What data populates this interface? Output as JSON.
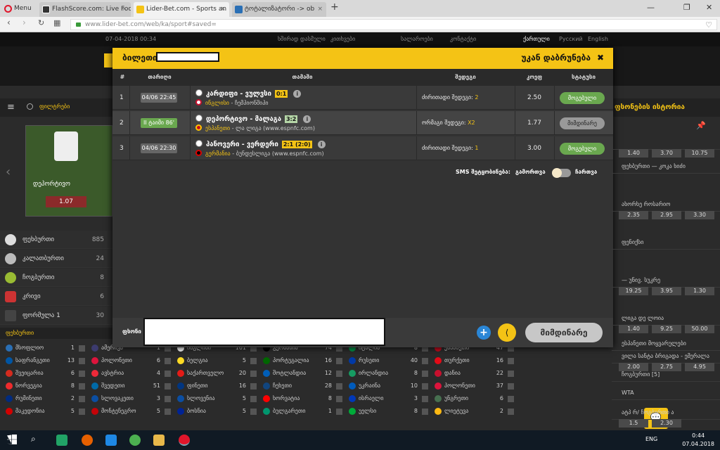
{
  "browser": {
    "menu_label": "Menu",
    "tabs": [
      {
        "label": "FlashScore.com: Live Footb",
        "active": false
      },
      {
        "label": "Lider-Bet.com - Sports an",
        "active": true
      },
      {
        "label": "ტოტალიზატორი -> ob",
        "active": false
      }
    ],
    "new_tab": "+",
    "url": "www.lider-bet.com/web/ka/sport#saved="
  },
  "site": {
    "datetime": "07-04-2018 00:34",
    "top_links": [
      "ხშირად დასმული",
      "კითხვები",
      "სალაროები",
      "კონტაქტი"
    ],
    "languages": [
      "ქართული",
      "Русский",
      "English"
    ],
    "search_label": "ფილტრები",
    "hero_team": "დეპორტივო",
    "hero_odds": "1.07",
    "sports": [
      {
        "name": "ფეხბურთი",
        "count": "885"
      },
      {
        "name": "კალათბურთი",
        "count": "24"
      },
      {
        "name": "ჩოგბურთი",
        "count": "8"
      },
      {
        "name": "კრივი",
        "count": "6"
      },
      {
        "name": "ფორმულა 1",
        "count": "30"
      }
    ],
    "countries_header": "ფეხბურთი",
    "countries": [
      {
        "name": "მსოფლიო",
        "count": "1"
      },
      {
        "name": "საფრანგეთი",
        "count": "13"
      },
      {
        "name": "შვეიცარია",
        "count": "6"
      },
      {
        "name": "ნორვეგია",
        "count": "8"
      },
      {
        "name": "რუმინეთი",
        "count": "2"
      },
      {
        "name": "მაკედონია",
        "count": "5"
      },
      {
        "name": "ამერიკა",
        "count": "1"
      },
      {
        "name": "პოლონეთი",
        "count": "6"
      },
      {
        "name": "ავსტრია",
        "count": "4"
      },
      {
        "name": "შვედეთი",
        "count": "51"
      },
      {
        "name": "სლოვაკეთი",
        "count": "3"
      },
      {
        "name": "მონტენეგრო",
        "count": "5"
      },
      {
        "name": "ინგლისი",
        "count": "161"
      },
      {
        "name": "ბელგია",
        "count": "5"
      },
      {
        "name": "საქართველო",
        "count": "20"
      },
      {
        "name": "ფინეთი",
        "count": "16"
      },
      {
        "name": "სლოვენია",
        "count": "5"
      },
      {
        "name": "ბოსნია",
        "count": "5"
      },
      {
        "name": "გერმანია",
        "count": "74"
      },
      {
        "name": "პორტუგალია",
        "count": "16"
      },
      {
        "name": "შოტლანდია",
        "count": "12"
      },
      {
        "name": "ჩეხეთი",
        "count": "28"
      },
      {
        "name": "ხორვატია",
        "count": "8"
      },
      {
        "name": "ბულგარეთი",
        "count": "1"
      },
      {
        "name": "იტალია",
        "count": "8"
      },
      {
        "name": "რუსეთი",
        "count": "40"
      },
      {
        "name": "ირლანდია",
        "count": "8"
      },
      {
        "name": "უკრაინა",
        "count": "10"
      },
      {
        "name": "ისრაელი",
        "count": "3"
      },
      {
        "name": "უელსი",
        "count": "8"
      },
      {
        "name": "ესპანეთი",
        "count": "47"
      },
      {
        "name": "თურქეთი",
        "count": "16"
      },
      {
        "name": "დანია",
        "count": "22"
      },
      {
        "name": "პოლონეთი",
        "count": "37"
      },
      {
        "name": "უნგრეთი",
        "count": "6"
      },
      {
        "name": "ლიეტუვა",
        "count": "2"
      }
    ],
    "right_panel": {
      "history_title": "ფსონების ისტორია",
      "rows": [
        {
          "text": "",
          "odds": [
            "1.40",
            "3.70",
            "10.75"
          ]
        },
        {
          "text": "ფეხბურთი — კოკა ხიძი",
          "odds": []
        },
        {
          "text": "ახორხე როსარიო",
          "odds": [
            "2.35",
            "2.95",
            "3.30"
          ]
        },
        {
          "text": "ფენიქსი",
          "odds": []
        },
        {
          "text": "— უნივ. სუკრე",
          "odds": [
            "19.25",
            "3.95",
            "1.30"
          ]
        },
        {
          "text": "ლიგა დე ლოია",
          "odds": [
            "1.40",
            "9.25",
            "50.00"
          ]
        },
        {
          "text": "ესპანეთი მოყვარულები",
          "odds": []
        },
        {
          "text": "ვილა სანტა ბრიგადა - ემერალა",
          "odds": [
            "2.00",
            "2.75",
            "4.95"
          ]
        },
        {
          "text": "ჩოგბურთი [5]",
          "odds": []
        },
        {
          "text": "WTA",
          "odds": []
        },
        {
          "text": "ატპ რ/ ჩოგბურთი ა",
          "odds": [
            "1.5",
            "2.30"
          ]
        }
      ],
      "live_label": "ბოლო",
      "live_minute": "43 წთ"
    }
  },
  "modal": {
    "title": "ბილეთი",
    "back_label": "უკან დაბრუნება",
    "close_icon": "✖",
    "columns": [
      "#",
      "თარიღი",
      "თამაში",
      "შედეგი",
      "კოეფ",
      "სტატუსი"
    ],
    "rows": [
      {
        "num": "1",
        "date": "04/06 22:45",
        "live": false,
        "match": "კარდიფი - ვულვსი",
        "score": "0:1",
        "score_style": "yellow",
        "country": "ინგლისი",
        "league": "ჩემპიონშიპი",
        "flag_color": "#fff",
        "flag_accent": "#c8102e",
        "result_label": "ძირითადი შედეგი:",
        "result_value": "2",
        "odds": "2.50",
        "status": "მოგებული",
        "status_kind": "win"
      },
      {
        "num": "2",
        "date": "II ტაიმი 86'",
        "live": true,
        "match": "დეპორტივო - მალაგა",
        "score": "3:2",
        "score_style": "green",
        "country": "ესპანეთი",
        "league": "ლა ლიგა (www.espnfc.com)",
        "flag_color": "#c60b1e",
        "flag_accent": "#ffc400",
        "result_label": "ორმაგი შედეგი:",
        "result_value": "X2",
        "odds": "1.77",
        "status": "მიმდინარე",
        "status_kind": "run"
      },
      {
        "num": "3",
        "date": "04/06 22:30",
        "live": false,
        "match": "ჰანოვერი - ვერდერი",
        "score": "2:1 (2:0)",
        "score_style": "yellow",
        "country": "გერმანია",
        "league": "ბუნდესლიგა (www.espnfc.com)",
        "flag_color": "#000",
        "flag_accent": "#dd0000",
        "result_label": "ძირითადი შედეგი:",
        "result_value": "1",
        "odds": "3.00",
        "status": "მოგებული",
        "status_kind": "win"
      }
    ],
    "sms_label": "SMS შეტყობინება:",
    "sms_off": "გამორთვა",
    "sms_on": "ჩართვა",
    "footer_label": "ფსონი",
    "current_button": "მიმდინარე"
  },
  "taskbar": {
    "lang": "ENG",
    "time": "0:44",
    "date": "07.04.2018"
  },
  "colors": {
    "accent_yellow": "#f4c315",
    "win_green": "#6aa84f",
    "plus_blue": "#2a86d6"
  }
}
